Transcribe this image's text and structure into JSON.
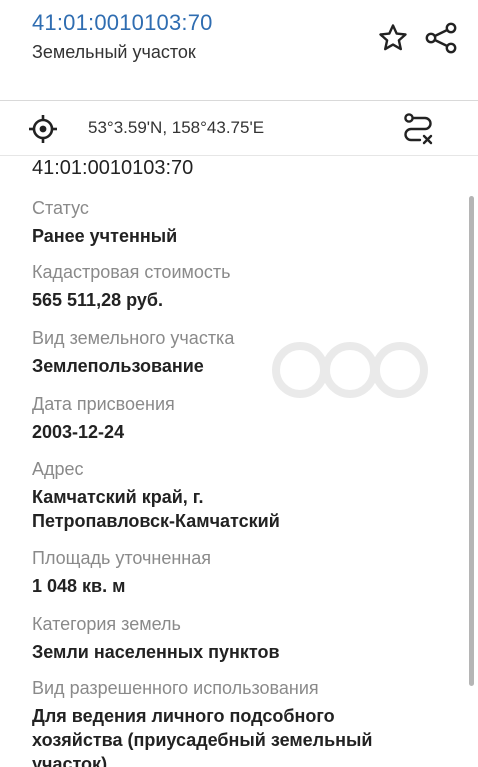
{
  "header": {
    "cadastral_id": "41:01:0010103:70",
    "subtitle": "Земельный участок",
    "star_icon": "star-outline-icon",
    "share_icon": "share-icon"
  },
  "coordinates": {
    "text": "53°3.59'N, 158°43.75'E",
    "locate_icon": "crosshair-icon",
    "route_icon": "route-icon"
  },
  "details": {
    "cadastral_number": "41:01:0010103:70",
    "fields": [
      {
        "label": "Статус",
        "value": "Ранее учтенный"
      },
      {
        "label": "Кадастровая стоимость",
        "value": "565 511,28 руб."
      },
      {
        "label": "Вид земельного участка",
        "value": "Землепользование"
      },
      {
        "label": "Дата присвоения",
        "value": "2003-12-24"
      },
      {
        "label": "Адрес",
        "value": "Камчатский край, г.\nПетропавловск-Камчатский"
      },
      {
        "label": "Площадь уточненная",
        "value": "1 048 кв. м"
      },
      {
        "label": "Категория земель",
        "value": "Земли населенных пунктов"
      },
      {
        "label": "Вид разрешенного использования",
        "value": "Для ведения личного подсобного\nхозяйства (приусадебный земельный\nучасток)"
      }
    ]
  },
  "colors": {
    "accent": "#2f6db1",
    "label": "#8a8a8a",
    "value": "#222222"
  }
}
